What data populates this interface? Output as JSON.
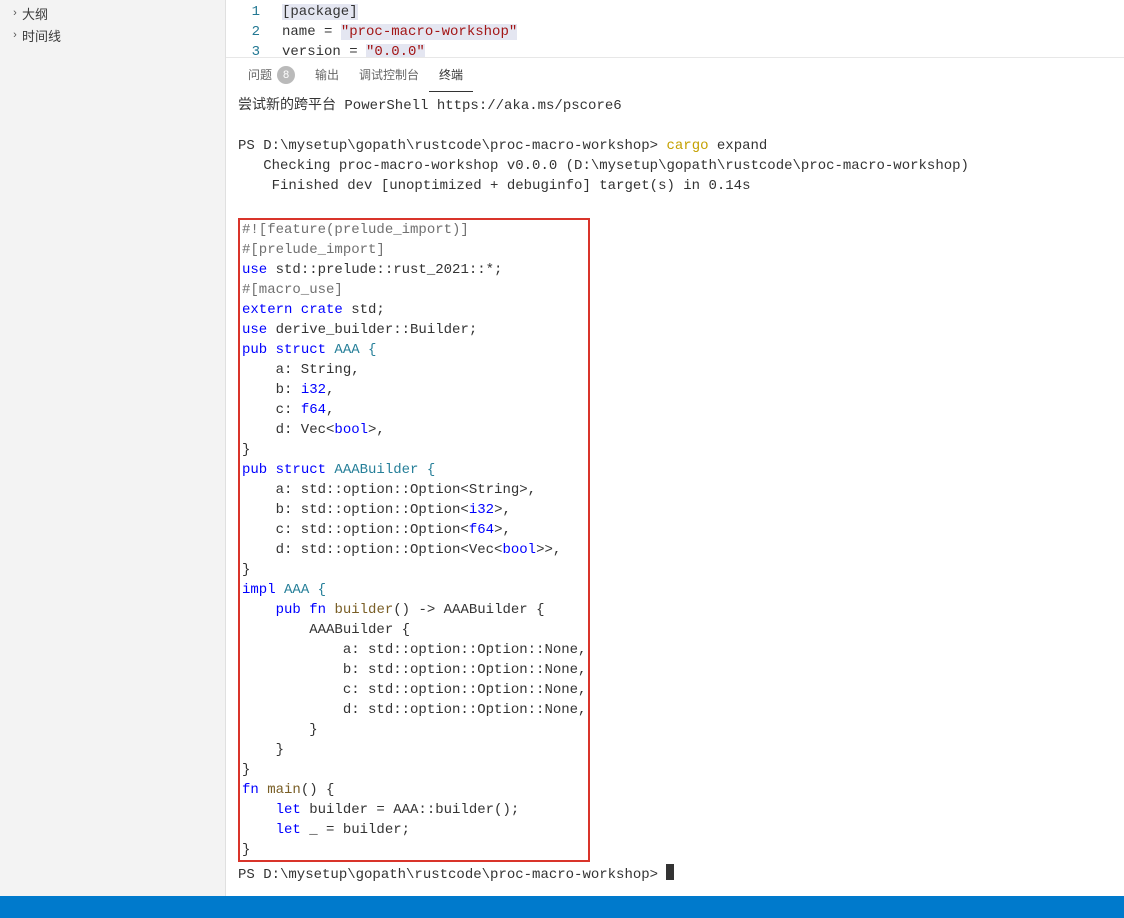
{
  "sidebar": {
    "items": [
      {
        "label": "大纲"
      },
      {
        "label": "时间线"
      }
    ]
  },
  "editor": {
    "lines": [
      {
        "num": "1",
        "pre": "",
        "hl": "[package]",
        "post": ""
      },
      {
        "num": "2",
        "pre": "name = ",
        "hl": "\"proc-macro-workshop\"",
        "post": ""
      },
      {
        "num": "3",
        "pre": "version = ",
        "hl": "\"0.0.0\"",
        "post": ""
      }
    ]
  },
  "panel": {
    "tabs": {
      "problems": "问题",
      "problems_count": "8",
      "output": "输出",
      "debug": "调试控制台",
      "terminal": "终端"
    }
  },
  "terminal": {
    "powershell_hint": "尝试新的跨平台 PowerShell https://aka.ms/pscore6",
    "prompt1": "PS D:\\mysetup\\gopath\\rustcode\\proc-macro-workshop> ",
    "cmd1_a": "cargo",
    "cmd1_b": " expand",
    "checking": "   Checking proc-macro-workshop v0.0.0 (D:\\mysetup\\gopath\\rustcode\\proc-macro-workshop)",
    "finished": "    Finished dev [unoptimized + debuginfo] target(s) in 0.14s",
    "code": {
      "l01a": "#![feature(prelude_import)]",
      "l02a": "#[prelude_import]",
      "l03_use": "use ",
      "l03_path": "std::prelude::rust_2021::*;",
      "l04a": "#[macro_use]",
      "l05_ext": "extern crate ",
      "l05_std": "std;",
      "l06_use": "use ",
      "l06_path": "derive_builder::Builder;",
      "l07_pub": "pub ",
      "l07_struct": "struct ",
      "l07_name": "AAA {",
      "l08": "    a: String,",
      "l09a": "    b: ",
      "l09b": "i32",
      "l09c": ",",
      "l10a": "    c: ",
      "l10b": "f64",
      "l10c": ",",
      "l11a": "    d: Vec<",
      "l11b": "bool",
      "l11c": ">,",
      "l12": "}",
      "l13_pub": "pub ",
      "l13_struct": "struct ",
      "l13_name": "AAABuilder {",
      "l14": "    a: std::option::Option<String>,",
      "l15a": "    b: std::option::Option<",
      "l15b": "i32",
      "l15c": ">,",
      "l16a": "    c: std::option::Option<",
      "l16b": "f64",
      "l16c": ">,",
      "l17a": "    d: std::option::Option<Vec<",
      "l17b": "bool",
      "l17c": ">>,",
      "l18": "}",
      "l19_impl": "impl ",
      "l19_name": "AAA {",
      "l20_pub": "    pub ",
      "l20_fn": "fn ",
      "l20_name": "builder",
      "l20_rest": "() -> AAABuilder {",
      "l21": "        AAABuilder {",
      "l22": "            a: std::option::Option::None,",
      "l23": "            b: std::option::Option::None,",
      "l24": "            c: std::option::Option::None,",
      "l25": "            d: std::option::Option::None,",
      "l26": "        }",
      "l27": "    }",
      "l28": "}",
      "l29_fn": "fn ",
      "l29_name": "main",
      "l29_rest": "() {",
      "l30a": "    let ",
      "l30b": "builder = AAA::builder();",
      "l31a": "    let ",
      "l31b": "_ = builder;",
      "l32": "}"
    },
    "prompt2": "PS D:\\mysetup\\gopath\\rustcode\\proc-macro-workshop> "
  }
}
